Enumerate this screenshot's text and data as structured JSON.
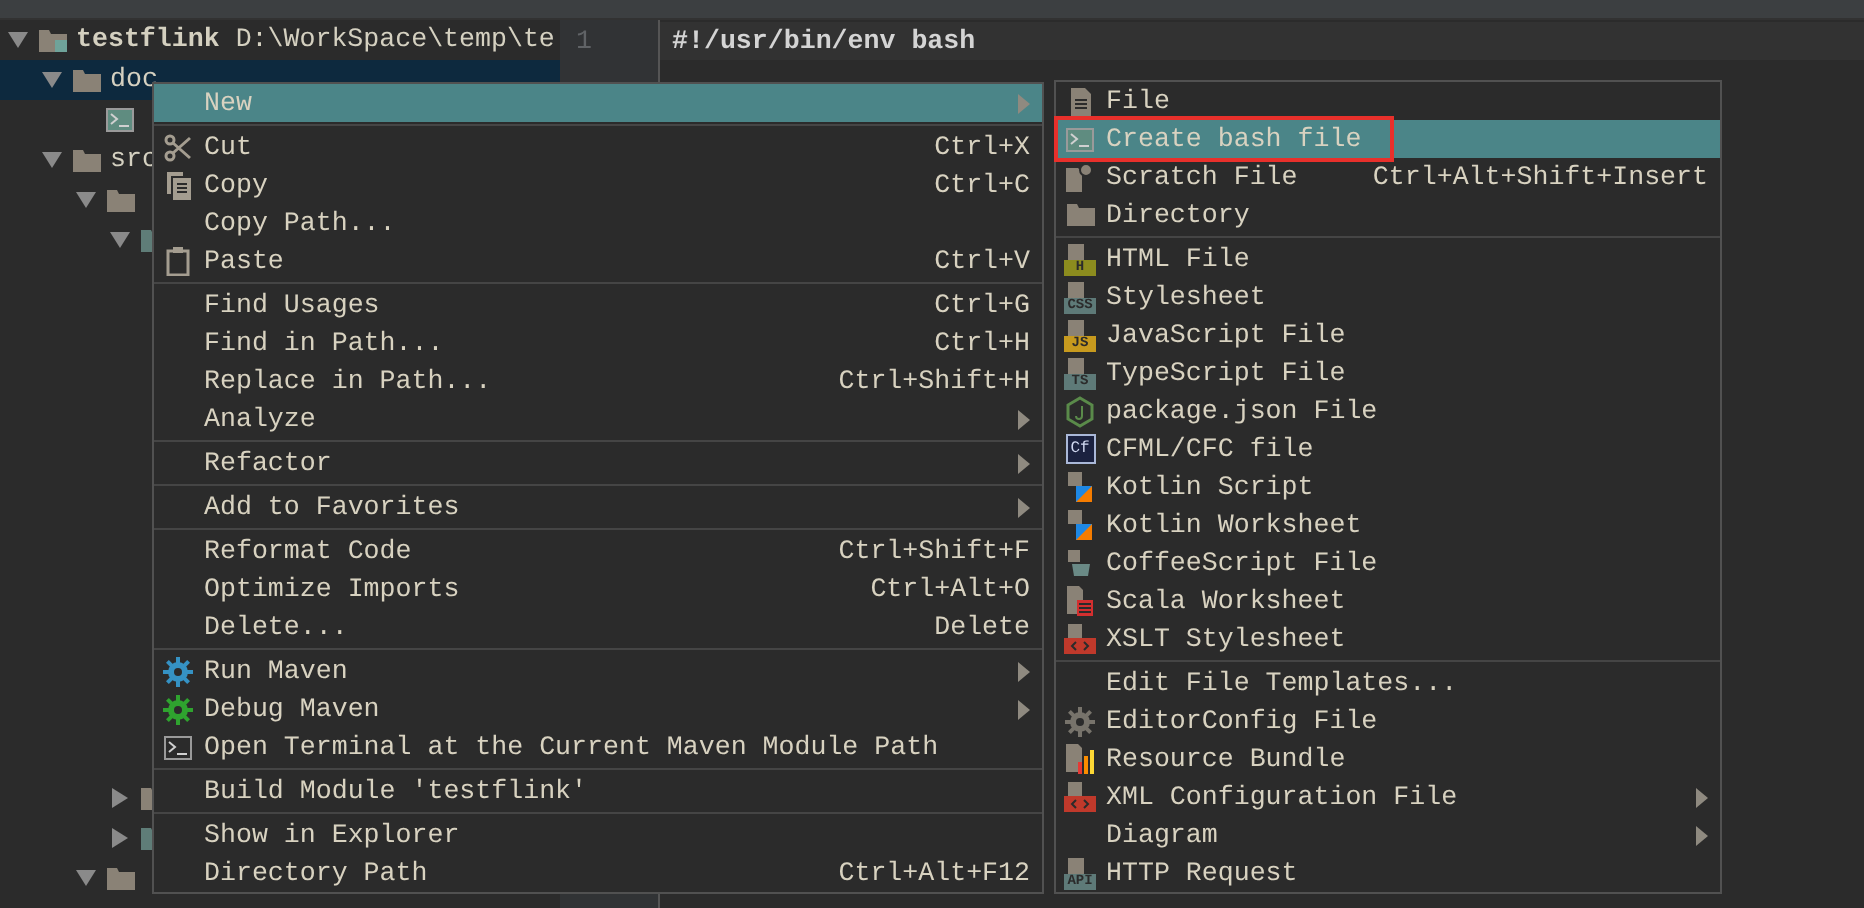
{
  "tree": [
    {
      "label": "testflink",
      "path": "D:\\WorkSpace\\temp\\te",
      "kind": "module",
      "expanded": true,
      "selected": false,
      "children": [
        {
          "label": "doc",
          "kind": "folder",
          "expanded": true,
          "selected": true,
          "children": [
            {
              "kind": "bash",
              "selected": false
            }
          ]
        },
        {
          "label": "src",
          "kind": "folder",
          "expanded": true,
          "selected": false,
          "children": [
            {
              "kind": "folder",
              "expanded": true,
              "selected": false,
              "children": [
                {
                  "kind": "source",
                  "expanded": true,
                  "selected": false
                }
              ]
            }
          ]
        }
      ]
    }
  ],
  "tree_lower": [
    {
      "kind": "folder",
      "expanded": false,
      "selected": false
    },
    {
      "kind": "source",
      "expanded": false,
      "selected": false
    }
  ],
  "tree_tail": [
    {
      "kind": "folder",
      "expanded": true,
      "selected": false
    }
  ],
  "editor": {
    "lines": [
      {
        "number": "1",
        "code": "#!/usr/bin/env bash"
      }
    ]
  },
  "context_menu": [
    {
      "label": "New",
      "kind": "plain",
      "selected": true,
      "submenu": true
    },
    {
      "kind": "separator"
    },
    {
      "label": "Cut",
      "kind": "scissors",
      "shortcut": "Ctrl+X",
      "selected": false
    },
    {
      "label": "Copy",
      "kind": "copy",
      "shortcut": "Ctrl+C",
      "selected": false
    },
    {
      "label": "Copy Path...",
      "kind": "plain",
      "selected": false
    },
    {
      "label": "Paste",
      "kind": "paste",
      "shortcut": "Ctrl+V",
      "selected": false
    },
    {
      "kind": "separator"
    },
    {
      "label": "Find Usages",
      "kind": "plain",
      "shortcut": "Ctrl+G",
      "selected": false
    },
    {
      "label": "Find in Path...",
      "kind": "plain",
      "shortcut": "Ctrl+H",
      "selected": false
    },
    {
      "label": "Replace in Path...",
      "kind": "plain",
      "shortcut": "Ctrl+Shift+H",
      "selected": false
    },
    {
      "label": "Analyze",
      "kind": "plain",
      "selected": false,
      "submenu": true
    },
    {
      "kind": "separator"
    },
    {
      "label": "Refactor",
      "kind": "plain",
      "selected": false,
      "submenu": true
    },
    {
      "kind": "separator"
    },
    {
      "label": "Add to Favorites",
      "kind": "plain",
      "selected": false,
      "submenu": true
    },
    {
      "kind": "separator"
    },
    {
      "label": "Reformat Code",
      "kind": "plain",
      "shortcut": "Ctrl+Shift+F",
      "selected": false
    },
    {
      "label": "Optimize Imports",
      "kind": "plain",
      "shortcut": "Ctrl+Alt+O",
      "selected": false
    },
    {
      "label": "Delete...",
      "kind": "plain",
      "shortcut": "Delete",
      "selected": false
    },
    {
      "kind": "separator"
    },
    {
      "label": "Run Maven",
      "kind": "gear",
      "color": "#3592c4",
      "selected": false,
      "submenu": true
    },
    {
      "label": "Debug Maven",
      "kind": "gear",
      "color": "#2fa32f",
      "selected": false,
      "submenu": true
    },
    {
      "label": "Open Terminal at the Current Maven Module Path",
      "kind": "terminal",
      "selected": false
    },
    {
      "kind": "separator"
    },
    {
      "label": "Build Module 'testflink'",
      "kind": "plain",
      "selected": false
    },
    {
      "kind": "separator"
    },
    {
      "label": "Show in Explorer",
      "kind": "plain",
      "selected": false
    },
    {
      "label": "Directory Path",
      "kind": "plain",
      "shortcut": "Ctrl+Alt+F12",
      "selected": false
    }
  ],
  "new_submenu": [
    {
      "label": "File",
      "kind": "file",
      "selected": false,
      "highlighted": false
    },
    {
      "label": "Create bash file",
      "kind": "bash",
      "selected": true,
      "highlighted": true
    },
    {
      "label": "Scratch File",
      "kind": "scratch",
      "shortcut": "Ctrl+Alt+Shift+Insert",
      "selected": false,
      "highlighted": false
    },
    {
      "label": "Directory",
      "kind": "folder",
      "selected": false,
      "highlighted": false
    },
    {
      "kind": "separator"
    },
    {
      "label": "HTML File",
      "kind": "badge",
      "badge": "H",
      "color": "#8c8c1e",
      "selected": false,
      "highlighted": false
    },
    {
      "label": "Stylesheet",
      "kind": "badge",
      "badge": "CSS",
      "color": "#5e7a78",
      "selected": false,
      "highlighted": false
    },
    {
      "label": "JavaScript File",
      "kind": "badge",
      "badge": "JS",
      "color": "#c79a1e",
      "selected": false,
      "highlighted": false
    },
    {
      "label": "TypeScript File",
      "kind": "badge",
      "badge": "TS",
      "color": "#5e7a78",
      "selected": false,
      "highlighted": false
    },
    {
      "label": "package.json File",
      "kind": "node",
      "selected": false,
      "highlighted": false
    },
    {
      "label": "CFML/CFC file",
      "kind": "cf",
      "badge": "Cf",
      "selected": false,
      "highlighted": false
    },
    {
      "label": "Kotlin Script",
      "kind": "kotlin",
      "selected": false,
      "highlighted": false
    },
    {
      "label": "Kotlin Worksheet",
      "kind": "kotlin",
      "selected": false,
      "highlighted": false
    },
    {
      "label": "CoffeeScript File",
      "kind": "cup",
      "selected": false,
      "highlighted": false
    },
    {
      "label": "Scala Worksheet",
      "kind": "scala",
      "selected": false,
      "highlighted": false
    },
    {
      "label": "XSLT Stylesheet",
      "kind": "tagfile",
      "selected": false,
      "highlighted": false
    },
    {
      "kind": "separator"
    },
    {
      "label": "Edit File Templates...",
      "kind": "plain",
      "selected": false,
      "highlighted": false
    },
    {
      "label": "EditorConfig File",
      "kind": "cog",
      "selected": false,
      "highlighted": false
    },
    {
      "label": "Resource Bundle",
      "kind": "bars",
      "selected": false,
      "highlighted": false
    },
    {
      "label": "XML Configuration File",
      "kind": "tagfile",
      "selected": false,
      "highlighted": false,
      "submenu": true
    },
    {
      "label": "Diagram",
      "kind": "plain",
      "selected": false,
      "highlighted": false,
      "submenu": true
    },
    {
      "label": "HTTP Request",
      "kind": "badge",
      "badge": "API",
      "color": "#5e7a78",
      "selected": false,
      "highlighted": false
    }
  ]
}
